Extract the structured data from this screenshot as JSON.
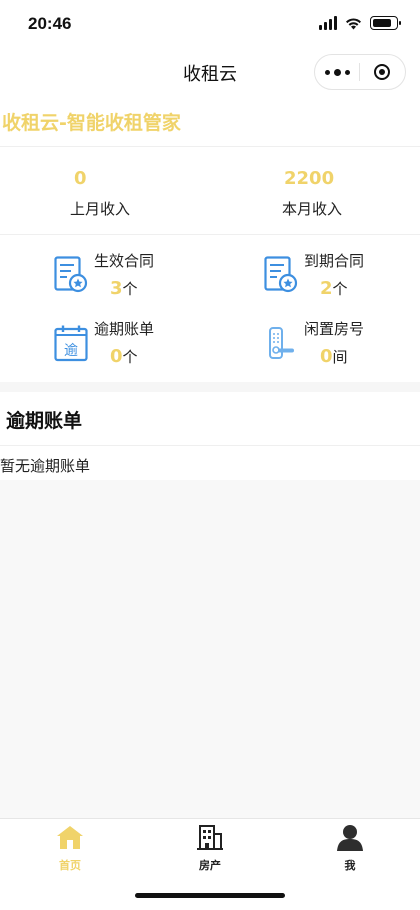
{
  "status_bar": {
    "time": "20:46"
  },
  "nav": {
    "title": "收租云"
  },
  "brand": {
    "text": "收租云-智能收租管家"
  },
  "income": [
    {
      "value": "0",
      "label": "上月收入"
    },
    {
      "value": "2200",
      "label": "本月收入"
    }
  ],
  "stats": [
    {
      "label": "生效合同",
      "value": "3",
      "unit": "个",
      "icon": "contract-icon"
    },
    {
      "label": "到期合同",
      "value": "2",
      "unit": "个",
      "icon": "contract-icon"
    },
    {
      "label": "逾期账单",
      "value": "0",
      "unit": "个",
      "icon": "calendar-bill-icon"
    },
    {
      "label": "闲置房号",
      "value": "0",
      "unit": "间",
      "icon": "door-lock-icon"
    }
  ],
  "overdue": {
    "title": "逾期账单",
    "empty_text": "暂无逾期账单"
  },
  "tabbar": {
    "items": [
      {
        "label": "首页",
        "icon": "home-icon",
        "active": true
      },
      {
        "label": "房产",
        "icon": "building-icon",
        "active": false
      },
      {
        "label": "我",
        "icon": "user-icon",
        "active": false
      }
    ]
  },
  "colors": {
    "accent": "#f0d36a",
    "icon_blue": "#3d8fe0",
    "text": "#222222"
  }
}
